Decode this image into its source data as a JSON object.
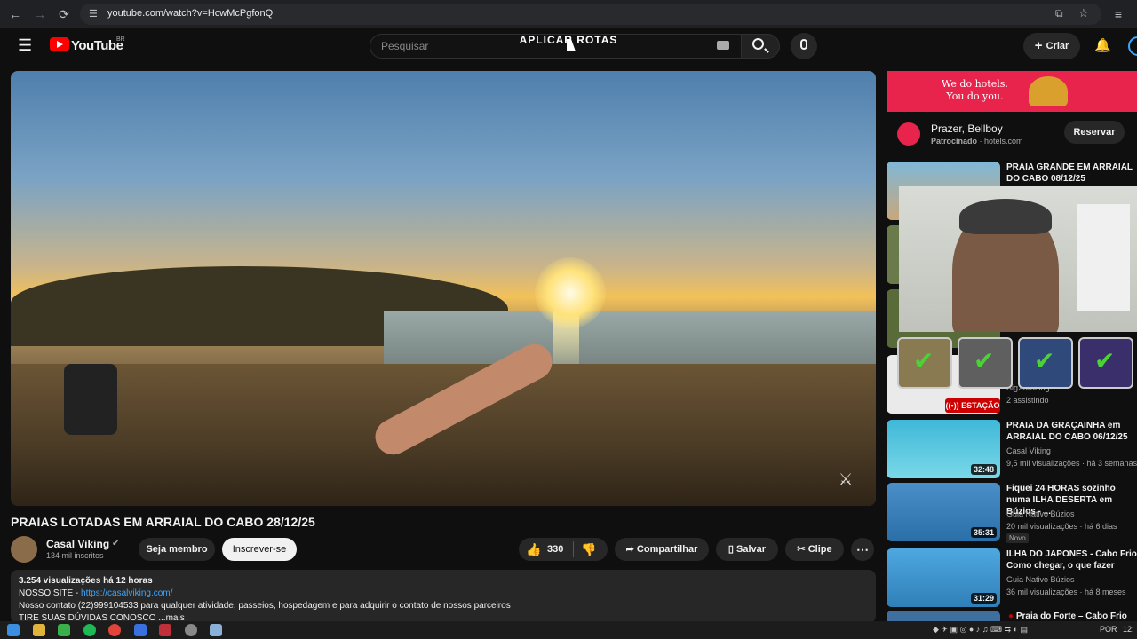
{
  "browser": {
    "url": "youtube.com/watch?v=HcwMcPgfonQ"
  },
  "header": {
    "logo_text": "YouTube",
    "region": "BR",
    "search_placeholder": "Pesquisar",
    "overlay_title": "APLICAR ROTAS",
    "create_label": "Criar"
  },
  "video": {
    "title": "PRAIAS LOTADAS EM ARRAIAL DO CABO 28/12/25",
    "channel": "Casal Viking",
    "subscribers": "134 mil inscritos",
    "join_label": "Seja membro",
    "subscribe_label": "Inscrever-se",
    "likes": "330",
    "share_label": "Compartilhar",
    "save_label": "Salvar",
    "clip_label": "Clipe"
  },
  "description": {
    "views_line": "3.254 visualizações  há 12 horas",
    "site_label": "NOSSO SITE - ",
    "site_link": "https://casalviking.com/",
    "contact_line": "Nosso contato (22)999104533 para qualquer atividade, passeios, hospedagem e para adquirir o contato de nossos parceiros",
    "truncated_line": "TIRE SUAS DÚVIDAS CONOSCO    ...mais"
  },
  "ad": {
    "banner_line1": "We do hotels.",
    "banner_line2": "You do you.",
    "title": "Prazer, Bellboy",
    "sponsor_label": "Patrocinado",
    "sponsor_site": "hotels.com",
    "button_label": "Reservar"
  },
  "recommendations": [
    {
      "title": "PRAIA GRANDE EM ARRAIAL DO CABO 08/12/25",
      "channel": "",
      "meta": "",
      "duration": ""
    },
    {
      "title": "",
      "channel": "BigXaral log",
      "meta": "2 assistindo",
      "duration": "",
      "live": "ESTAÇÃO"
    },
    {
      "title": "PRAIA DA GRAÇAINHA em ARRAIAL DO CABO 06/12/25",
      "channel": "Casal Viking",
      "meta": "9,5 mil visualizações · há 3 semanas",
      "duration": "32:48"
    },
    {
      "title": "Fiquei 24 HORAS sozinho numa ILHA DESERTA em Búzios - ...",
      "channel": "Guia Nativo Búzios",
      "meta": "20 mil visualizações · há 6 dias",
      "duration": "35:31",
      "badge": "Novo"
    },
    {
      "title": "ILHA DO JAPONES - Cabo Frio Como chegar, o que fazer",
      "channel": "Guia Nativo Búzios",
      "meta": "36 mil visualizações · há 8 meses",
      "duration": "31:29"
    },
    {
      "title": "Praia do Forte – Cabo Frio",
      "channel": "",
      "meta": "",
      "duration": ""
    }
  ],
  "taskbar": {
    "language": "POR",
    "clock": "12:"
  },
  "colors": {
    "background": "#0f0f0f",
    "accent_red": "#ff0000",
    "ad_banner": "#e8244c",
    "link": "#3ea6ff"
  }
}
